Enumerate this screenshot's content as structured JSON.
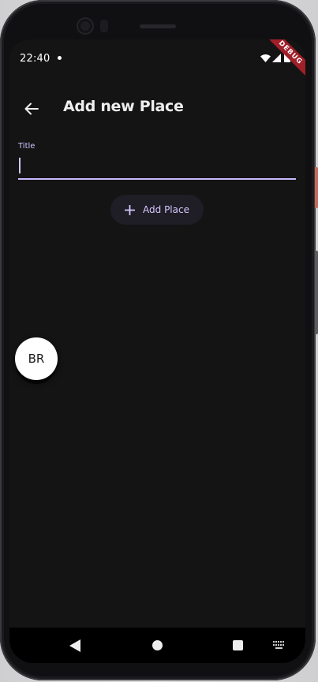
{
  "status_bar": {
    "time": "22:40",
    "debug_banner": "DEBUG"
  },
  "app_bar": {
    "title": "Add new Place",
    "back_icon": "arrow-back-icon"
  },
  "form": {
    "title_field": {
      "label": "Title",
      "value": "",
      "placeholder": ""
    },
    "add_button": {
      "icon": "plus-icon",
      "label": "Add Place"
    }
  },
  "avatar": {
    "initials": "BR"
  },
  "nav_bar": {
    "back_icon": "triangle-back-icon",
    "home_icon": "circle-home-icon",
    "recent_icon": "square-recents-icon",
    "keyboard_icon": "keyboard-icon"
  },
  "colors": {
    "background": "#141414",
    "accent": "#c9b8ff",
    "button_bg": "#1f1d25",
    "text": "#eeeeee",
    "debug_ribbon": "#a0202a"
  }
}
